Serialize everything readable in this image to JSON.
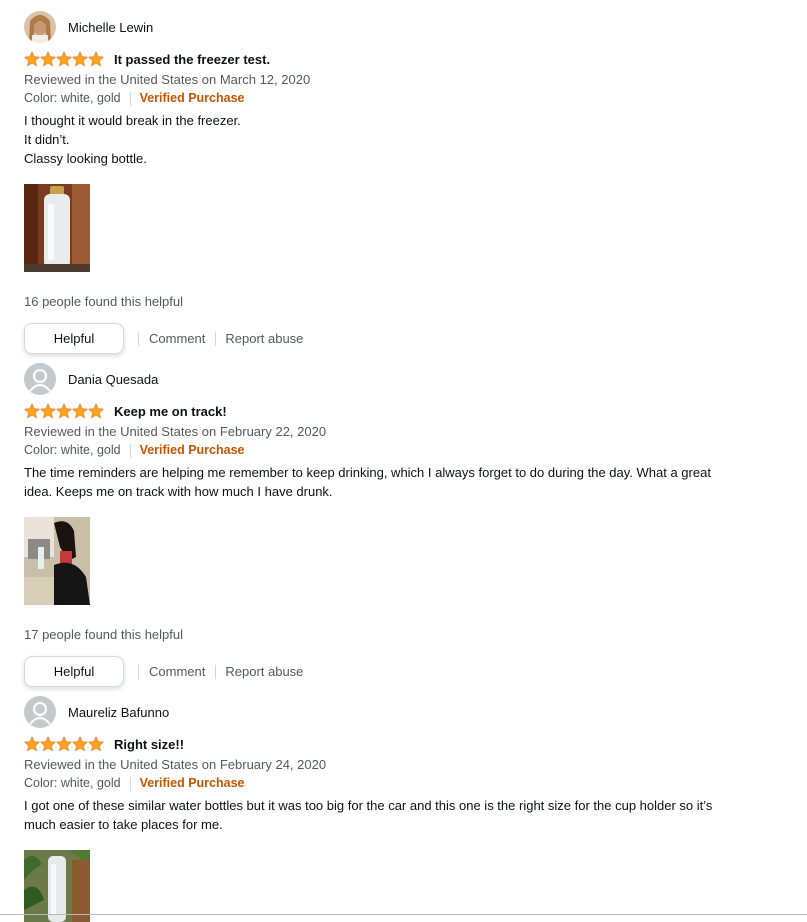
{
  "helpful_label": "Helpful",
  "comment_label": "Comment",
  "report_label": "Report abuse",
  "star_color": "#ffa41c",
  "verified_color": "#c45500",
  "reviews": [
    {
      "reviewer": "Michelle Lewin",
      "stars": 5,
      "title": "It passed the freezer test.",
      "date": "Reviewed in the United States on March 12, 2020",
      "color": "Color: white, gold",
      "verified": "Verified Purchase",
      "body": [
        "I thought it would break in the freezer.",
        "It didn’t.",
        "Classy looking bottle."
      ],
      "helpful_count": "16 people found this helpful"
    },
    {
      "reviewer": "Dania Quesada",
      "stars": 5,
      "title": "Keep me on track!",
      "date": "Reviewed in the United States on February 22, 2020",
      "color": "Color: white, gold",
      "verified": "Verified Purchase",
      "body": [
        "The time reminders are helping me remember to keep drinking, which I always forget to do during the day. What a great idea. Keeps me on track with how much I have drunk."
      ],
      "helpful_count": "17 people found this helpful"
    },
    {
      "reviewer": "Maureliz Bafunno",
      "stars": 5,
      "title": "Right size!!",
      "date": "Reviewed in the United States on February 24, 2020",
      "color": "Color: white, gold",
      "verified": "Verified Purchase",
      "body": [
        "I got one of these similar water bottles but it was too big for the car and this one is the right size for the cup holder so it’s much easier to take places for me."
      ],
      "helpful_count": ""
    }
  ]
}
